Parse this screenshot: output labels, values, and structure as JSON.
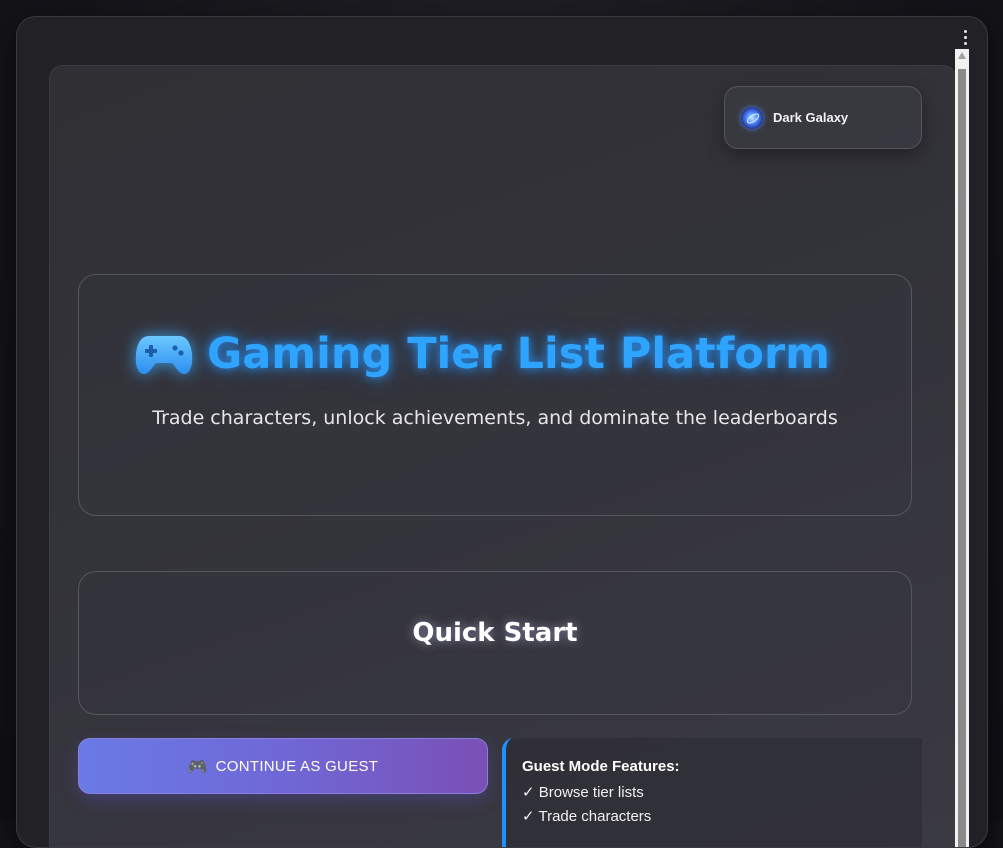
{
  "theme": {
    "label": "Dark Galaxy",
    "icon": "galaxy-icon"
  },
  "hero": {
    "icon": "gamepad-icon",
    "title": "Gaming Tier List Platform",
    "subtitle": "Trade characters, unlock achievements, and dominate the leaderboards"
  },
  "quick_start": {
    "title": "Quick Start"
  },
  "guest_button": {
    "icon": "🎮",
    "label": "CONTINUE AS GUEST"
  },
  "guest_features": {
    "title": "Guest Mode Features:",
    "items": [
      "✓ Browse tier lists",
      "✓ Trade characters"
    ]
  },
  "colors": {
    "accent": "#2ea4ff",
    "button_start": "#6a7ae6",
    "button_end": "#7a50b5",
    "feature_border": "#1e90ff"
  }
}
